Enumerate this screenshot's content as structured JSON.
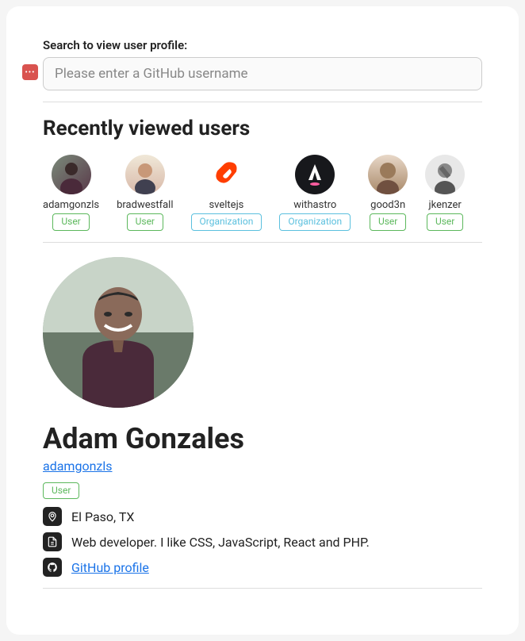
{
  "search": {
    "label": "Search to view user profile:",
    "placeholder": "Please enter a GitHub username"
  },
  "recent": {
    "title": "Recently viewed users",
    "items": [
      {
        "username": "adamgonzls",
        "type": "User"
      },
      {
        "username": "bradwestfall",
        "type": "User"
      },
      {
        "username": "sveltejs",
        "type": "Organization"
      },
      {
        "username": "withastro",
        "type": "Organization"
      },
      {
        "username": "good3n",
        "type": "User"
      },
      {
        "username": "jkenzer",
        "type": "User"
      }
    ]
  },
  "profile": {
    "name": "Adam Gonzales",
    "username": "adamgonzls",
    "type": "User",
    "location": "El Paso, TX",
    "bio": "Web developer. I like CSS, JavaScript, React and PHP.",
    "github_link_label": "GitHub profile"
  }
}
